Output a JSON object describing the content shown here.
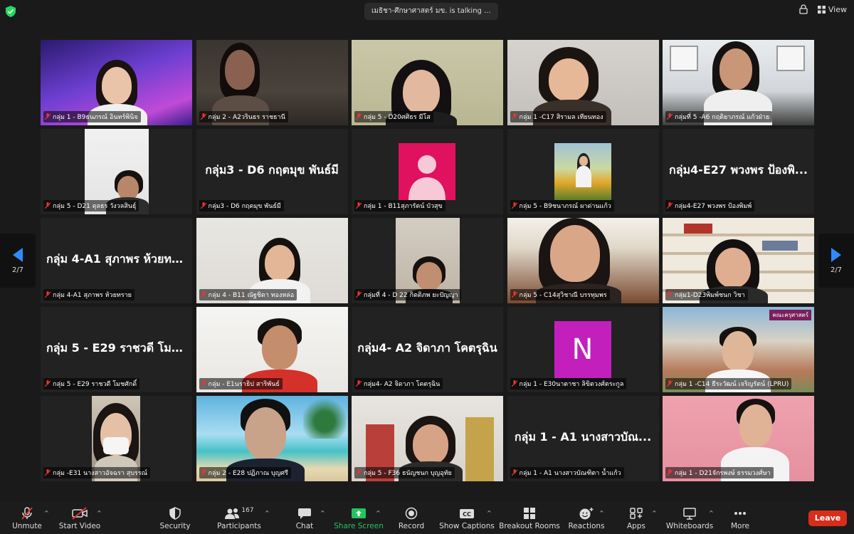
{
  "header": {
    "talking": "เมธิชา-ศึกษาศาสตร์ มข. is talking ...",
    "view_label": "View",
    "security_color": "#23d959"
  },
  "pager": {
    "left": "2/7",
    "right": "2/7"
  },
  "tiles": [
    {
      "caption": "กลุ่ม 1 - B9ธนภรณ์ อินทร์พินิจ",
      "big": ""
    },
    {
      "caption": "กลุ่ม 2 - A2วรินธร ราชธานี",
      "big": ""
    },
    {
      "caption": "กลุ่ม 5 - D20ศศิธร มีโส",
      "big": ""
    },
    {
      "caption": "กลุ่ม 1 -C17 สิรามล เทียนทอง",
      "big": ""
    },
    {
      "caption": "กลุ่มที่ 5 -A6 กฤติยาภรณ์ แก้วฝ่าย",
      "big": ""
    },
    {
      "caption": "กลุ่ม 5 - D21 ดุลธร วังวลสินธุ์",
      "big": ""
    },
    {
      "caption": "กลุ่ม3 - D6  กฤตมุข พันธ์มี",
      "big": "กลุ่ม3 - D6  กฤตมุข พันธ์มี"
    },
    {
      "caption": "กลุ่ม 1 - B11สุภารัตน์ บัวสุข",
      "big": ""
    },
    {
      "caption": "กลุ่ม 5 - B9ชนาภรณ์ ผาด่านแก้ว",
      "big": ""
    },
    {
      "caption": "กลุ่ม4-E27 พวงพร ป้องพิมพ์",
      "big": "กลุ่ม4-E27 พวงพร ป้องพิ..."
    },
    {
      "caption": "กลุ่ม 4-A1 สุภาพร ห้วยทราย",
      "big": "กลุ่ม 4-A1 สุภาพร ห้วยทร..."
    },
    {
      "caption": "กลุ่ม 4 - B11 ณัฐชิดา ทองหล่อ",
      "big": ""
    },
    {
      "caption": "กลุ่มที่ 4 - D 22 กิตติภพ ยะปัญญา",
      "big": ""
    },
    {
      "caption": "กลุ่ม 5 - C14สุวิชาณี บรรทุมพร",
      "big": ""
    },
    {
      "caption": "กลุ่ม1-D23พิมพ์ชนก วิชา",
      "big": ""
    },
    {
      "caption": "กลุ่ม 5 - E29 ราชวดี โมชศักดิ์",
      "big": "กลุ่ม 5 - E29 ราชวดี โมช..."
    },
    {
      "caption": "กลุ่ม  - E1นราธิป สาริพันธ์",
      "big": ""
    },
    {
      "caption": "กลุ่ม4- A2 จิดาภา โคตรุฉิน",
      "big": "กลุ่ม4- A2 จิดาภา โคตรุฉิน"
    },
    {
      "caption": "กลุ่ม 1 - E30นาตาชา ลิขิตวงศ์ตระกูล",
      "big": ""
    },
    {
      "caption": "กลุ่ม 1 -C14 ธีระวัฒน์ เจริญรัตน์ (LPRU)",
      "big": ""
    },
    {
      "caption": "กลุ่ม -E31 นางสาวอัจฉรา สุบรรณ์",
      "big": ""
    },
    {
      "caption": "กลุ่ม 2 - E28 ปฏิภาณ บุญศรี",
      "big": ""
    },
    {
      "caption": "กลุ่ม 5 - F36 ธนัญชนก บุญอุทัย",
      "big": ""
    },
    {
      "caption": "กลุ่ม 1 - A1 นางสาวบัณฑิตา น้ำแก้ว",
      "big": "กลุ่ม 1 - A1 นางสาวบัณ..."
    },
    {
      "caption": "กลุ่ม 1 - D21จักรพงษ์ ธรรมวงศ์ษา",
      "big": ""
    }
  ],
  "tile_extra": {
    "avatar_letter": "N",
    "logo_text": "คณะครุศาสตร์"
  },
  "toolbar": {
    "unmute": "Unmute",
    "start_video": "Start Video",
    "security": "Security",
    "participants": "Participants",
    "participants_count": "167",
    "chat": "Chat",
    "share_screen": "Share Screen",
    "record": "Record",
    "show_captions": "Show Captions",
    "breakout_rooms": "Breakout Rooms",
    "reactions": "Reactions",
    "apps": "Apps",
    "whiteboards": "Whiteboards",
    "more": "More",
    "leave": "Leave",
    "share_color": "#22c55e",
    "leave_color": "#d92d1c"
  }
}
